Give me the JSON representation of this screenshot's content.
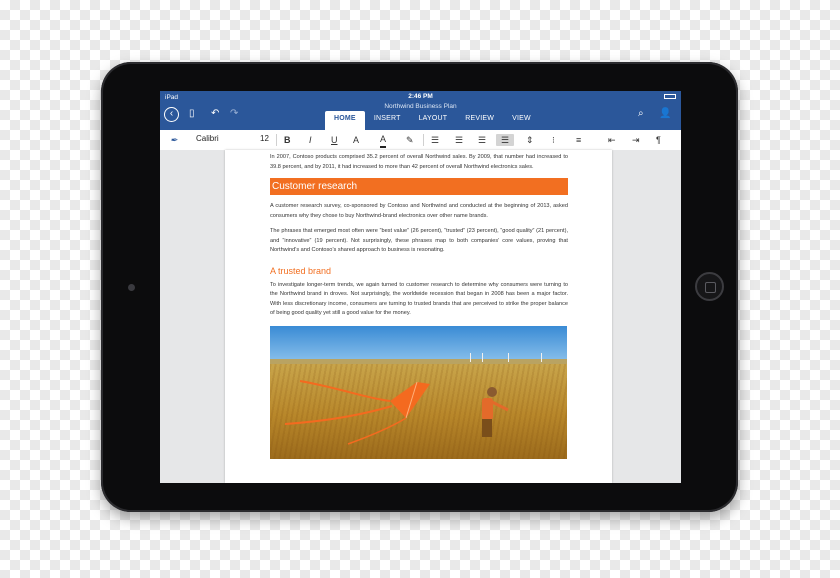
{
  "status": {
    "carrier": "iPad",
    "time": "2:46 PM"
  },
  "document": {
    "title": "Northwind Business Plan"
  },
  "tabs": [
    "HOME",
    "INSERT",
    "LAYOUT",
    "REVIEW",
    "VIEW"
  ],
  "active_tab": "HOME",
  "ribbon": {
    "font_name": "Calibri",
    "font_size": "12",
    "bold": "B",
    "italic": "I",
    "underline": "U",
    "strike": "A",
    "font_color": "A",
    "paragraph_mark": "¶"
  },
  "content": {
    "intro": "In 2007, Contoso products comprised 35.2 percent of overall Northwind sales. By 2009, that number had increased to 39.8 percent, and by 2011, it had increased to more than 42 percent of overall Northwind electronics sales.",
    "heading1": "Customer research",
    "para1": "A customer research survey, co-sponsored by Contoso and Northwind and conducted at the beginning of 2013, asked consumers why they chose to buy Northwind-brand electronics over other name brands.",
    "para2": "The phrases that emerged most often were “best value” (26 percent), “trusted” (23 percent), “good quality” (21 percent), and “innovative” (19 percent). Not surprisingly, these phrases map to both companies’ core values, proving that Northwind’s and Contoso’s shared approach to business is resonating.",
    "heading2": "A trusted brand",
    "para3": "To investigate longer-term trends, we again turned to customer research to determine why consumers were turning to the Northwind brand in droves. Not surprisingly, the worldwide recession that began in 2008 has been a major factor. With less discretionary income, consumers are turning to trusted brands that are perceived to strike the proper balance of being good quality yet still a good value for the money."
  },
  "icons": [
    "back-arrow-icon",
    "file-icon",
    "undo-icon",
    "redo-icon",
    "search-icon",
    "share-person-icon",
    "pen-icon",
    "highlighter-icon",
    "align-left-icon",
    "align-center-icon",
    "align-right-icon",
    "justify-icon",
    "line-spacing-icon",
    "bullets-icon",
    "numbering-icon",
    "indent-icon",
    "pilcrow-icon"
  ],
  "colors": {
    "word_blue": "#2b579a",
    "heading_orange": "#f26f21"
  }
}
